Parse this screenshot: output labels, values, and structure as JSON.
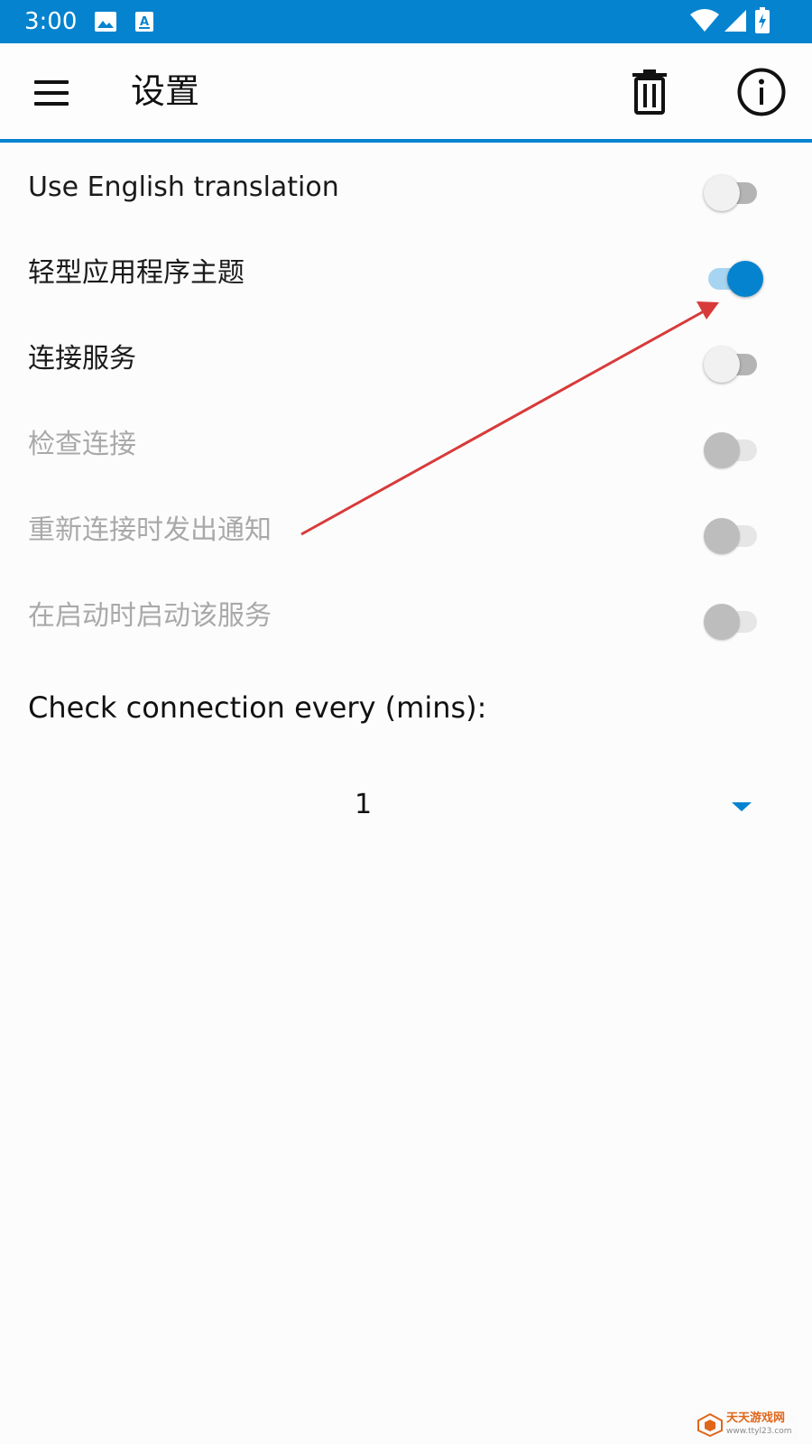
{
  "status_bar": {
    "time": "3:00",
    "left_icons": [
      "image-icon",
      "text-a-icon"
    ],
    "right_icons": [
      "wifi-icon",
      "signal-icon",
      "battery-charging-icon"
    ],
    "background": "#0683cf"
  },
  "app_bar": {
    "title": "设置",
    "icons": [
      "menu-icon",
      "delete-icon",
      "info-icon"
    ],
    "accent": "#0683cf"
  },
  "settings": [
    {
      "label": "Use English translation",
      "checked": false,
      "enabled": true
    },
    {
      "label": "轻型应用程序主题",
      "checked": true,
      "enabled": true
    },
    {
      "label": "连接服务",
      "checked": false,
      "enabled": true
    },
    {
      "label": "检查连接",
      "checked": false,
      "enabled": false
    },
    {
      "label": "重新连接时发出通知",
      "checked": false,
      "enabled": false
    },
    {
      "label": "在启动时启动该服务",
      "checked": false,
      "enabled": false
    }
  ],
  "interval": {
    "label": "Check connection every (mins):",
    "selected": "1"
  },
  "annotation": {
    "type": "arrow",
    "color": "#d83a3a"
  },
  "watermark": {
    "name": "天天游戏网",
    "url": "www.ttyl23.com"
  }
}
